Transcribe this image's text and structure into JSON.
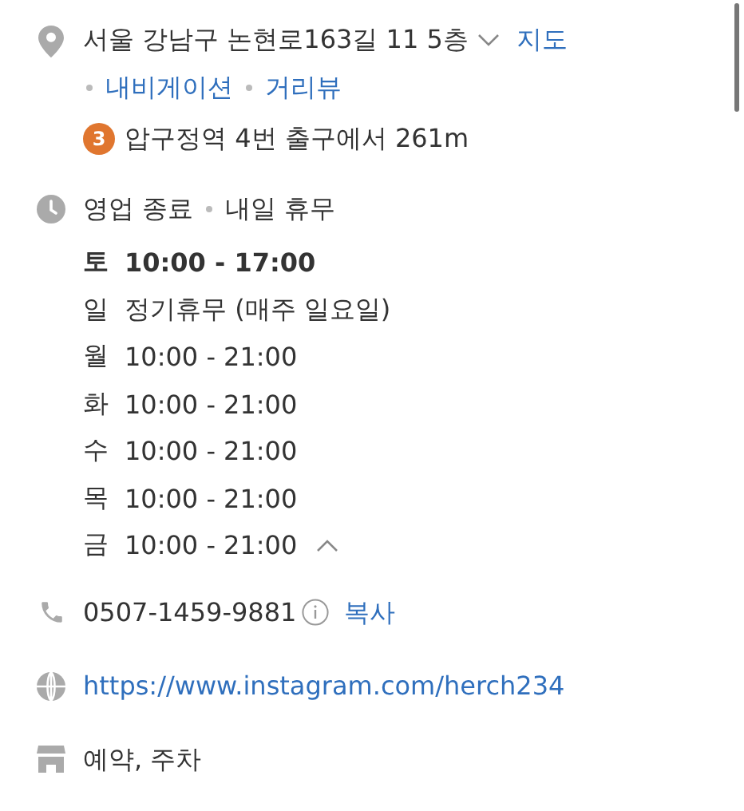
{
  "address": {
    "text": "서울 강남구 논현로163길 11 5층",
    "expanded": false,
    "links": [
      {
        "label": "지도"
      },
      {
        "label": "내비게이션"
      },
      {
        "label": "거리뷰"
      }
    ]
  },
  "subway": {
    "line": "3",
    "color": "#e0762f",
    "text": "압구정역 4번 출구에서 261m"
  },
  "status": {
    "state": "영업 종료",
    "next": "내일 휴무"
  },
  "hours": {
    "expanded": true,
    "days": [
      {
        "day": "토",
        "time": "10:00 - 17:00",
        "selected": true
      },
      {
        "day": "일",
        "time": "정기휴무 (매주 일요일)",
        "selected": false
      },
      {
        "day": "월",
        "time": "10:00 - 21:00",
        "selected": false
      },
      {
        "day": "화",
        "time": "10:00 - 21:00",
        "selected": false
      },
      {
        "day": "수",
        "time": "10:00 - 21:00",
        "selected": false
      },
      {
        "day": "목",
        "time": "10:00 - 21:00",
        "selected": false
      },
      {
        "day": "금",
        "time": "10:00 - 21:00",
        "selected": false
      }
    ]
  },
  "phone": {
    "number": "0507-1459-9881",
    "copy": "복사"
  },
  "website": {
    "url": "https://www.instagram.com/herch234"
  },
  "amenities": {
    "text": "예약, 주차"
  }
}
